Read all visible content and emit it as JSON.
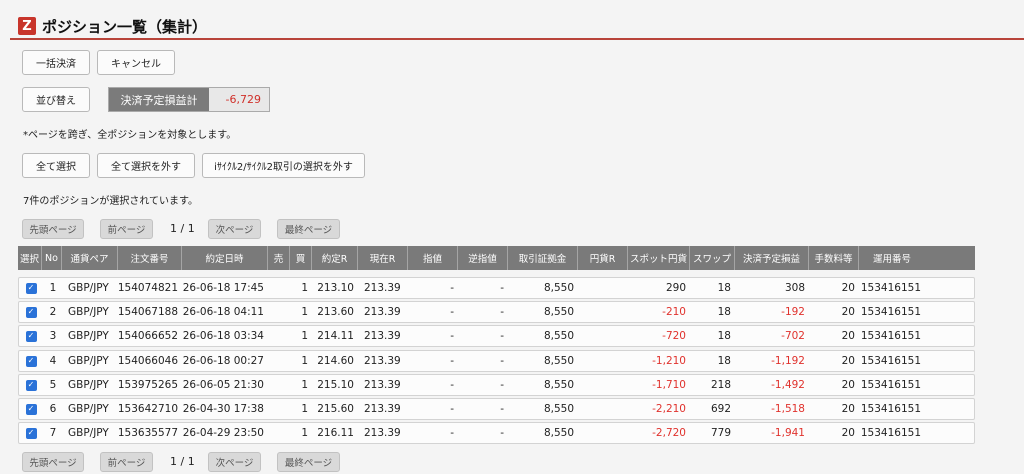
{
  "header": {
    "logo_text": "Z",
    "title": "ポジション一覧（集計）"
  },
  "buttons": {
    "bulk_settle": "一括決済",
    "cancel": "キャンセル",
    "sort": "並び替え",
    "select_all": "全て選択",
    "deselect_all": "全て選択を外す",
    "deselect_icycle": "iｻｲｸﾙ2/ｻｲｸﾙ2取引の選択を外す"
  },
  "pnl": {
    "label": "決済予定損益計",
    "value": "-6,729"
  },
  "notes": {
    "cross_page": "*ページを跨ぎ、全ポジションを対象とします。",
    "selected_count": "7件のポジションが選択されています。"
  },
  "pagination": {
    "first": "先頭ページ",
    "prev": "前ページ",
    "info": "1 / 1",
    "next": "次ページ",
    "last": "最終ページ"
  },
  "table": {
    "headers": [
      "選択",
      "No",
      "通貨ペア",
      "注文番号",
      "約定日時",
      "売",
      "買",
      "約定R",
      "現在R",
      "指値",
      "逆指値",
      "取引証拠金",
      "円貨R",
      "スポット円貨",
      "スワップ",
      "決済予定損益",
      "手数料等",
      "運用番号"
    ],
    "rows": [
      {
        "no": "1",
        "pair": "GBP/JPY",
        "order": "154074821",
        "datetime": "26-06-18 17:45",
        "sell": "",
        "buy": "1",
        "exec_rate": "213.10",
        "cur_rate": "213.39",
        "limit": "-",
        "stop": "-",
        "margin": "8,550",
        "yen_rate": "",
        "spot": "290",
        "swap": "18",
        "pnl": "308",
        "fee": "20",
        "op_no": "153416151"
      },
      {
        "no": "2",
        "pair": "GBP/JPY",
        "order": "154067188",
        "datetime": "26-06-18 04:11",
        "sell": "",
        "buy": "1",
        "exec_rate": "213.60",
        "cur_rate": "213.39",
        "limit": "-",
        "stop": "-",
        "margin": "8,550",
        "yen_rate": "",
        "spot": "-210",
        "swap": "18",
        "pnl": "-192",
        "fee": "20",
        "op_no": "153416151"
      },
      {
        "no": "3",
        "pair": "GBP/JPY",
        "order": "154066652",
        "datetime": "26-06-18 03:34",
        "sell": "",
        "buy": "1",
        "exec_rate": "214.11",
        "cur_rate": "213.39",
        "limit": "-",
        "stop": "-",
        "margin": "8,550",
        "yen_rate": "",
        "spot": "-720",
        "swap": "18",
        "pnl": "-702",
        "fee": "20",
        "op_no": "153416151"
      },
      {
        "no": "4",
        "pair": "GBP/JPY",
        "order": "154066046",
        "datetime": "26-06-18 00:27",
        "sell": "",
        "buy": "1",
        "exec_rate": "214.60",
        "cur_rate": "213.39",
        "limit": "-",
        "stop": "-",
        "margin": "8,550",
        "yen_rate": "",
        "spot": "-1,210",
        "swap": "18",
        "pnl": "-1,192",
        "fee": "20",
        "op_no": "153416151"
      },
      {
        "no": "5",
        "pair": "GBP/JPY",
        "order": "153975265",
        "datetime": "26-06-05 21:30",
        "sell": "",
        "buy": "1",
        "exec_rate": "215.10",
        "cur_rate": "213.39",
        "limit": "-",
        "stop": "-",
        "margin": "8,550",
        "yen_rate": "",
        "spot": "-1,710",
        "swap": "218",
        "pnl": "-1,492",
        "fee": "20",
        "op_no": "153416151"
      },
      {
        "no": "6",
        "pair": "GBP/JPY",
        "order": "153642710",
        "datetime": "26-04-30 17:38",
        "sell": "",
        "buy": "1",
        "exec_rate": "215.60",
        "cur_rate": "213.39",
        "limit": "-",
        "stop": "-",
        "margin": "8,550",
        "yen_rate": "",
        "spot": "-2,210",
        "swap": "692",
        "pnl": "-1,518",
        "fee": "20",
        "op_no": "153416151"
      },
      {
        "no": "7",
        "pair": "GBP/JPY",
        "order": "153635577",
        "datetime": "26-04-29 23:50",
        "sell": "",
        "buy": "1",
        "exec_rate": "216.11",
        "cur_rate": "213.39",
        "limit": "-",
        "stop": "-",
        "margin": "8,550",
        "yen_rate": "",
        "spot": "-2,720",
        "swap": "779",
        "pnl": "-1,941",
        "fee": "20",
        "op_no": "153416151"
      }
    ]
  },
  "colors": {
    "accent": "#c8352b",
    "negative": "#e0322d",
    "checkbox": "#2a72d8",
    "header_bg": "#7a7a7a"
  }
}
